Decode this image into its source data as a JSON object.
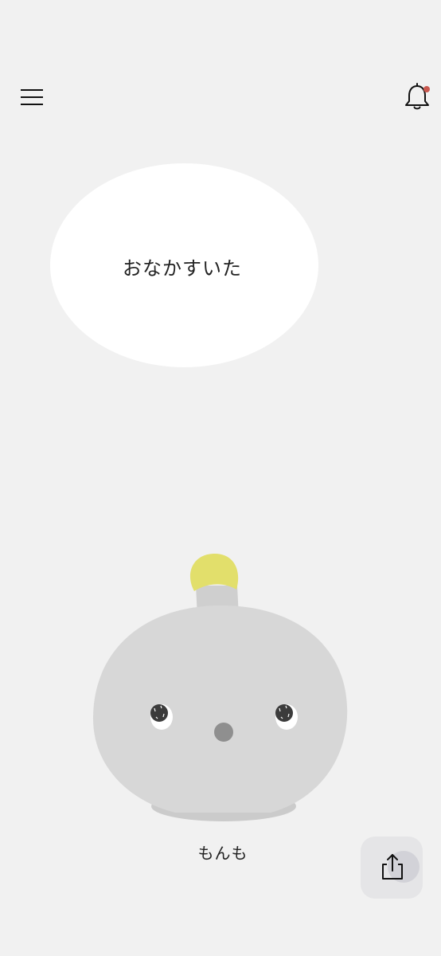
{
  "header": {
    "menu_icon": "hamburger-menu-icon",
    "notification_icon": "bell-icon",
    "has_notification": true,
    "notification_dot_color": "#c9584f"
  },
  "speech_bubble": {
    "text": "おなかすいた"
  },
  "character": {
    "name": "もんも",
    "body_color": "#d7d7d7",
    "sprout_color": "#e2df6b"
  },
  "share": {
    "icon": "share-icon"
  }
}
